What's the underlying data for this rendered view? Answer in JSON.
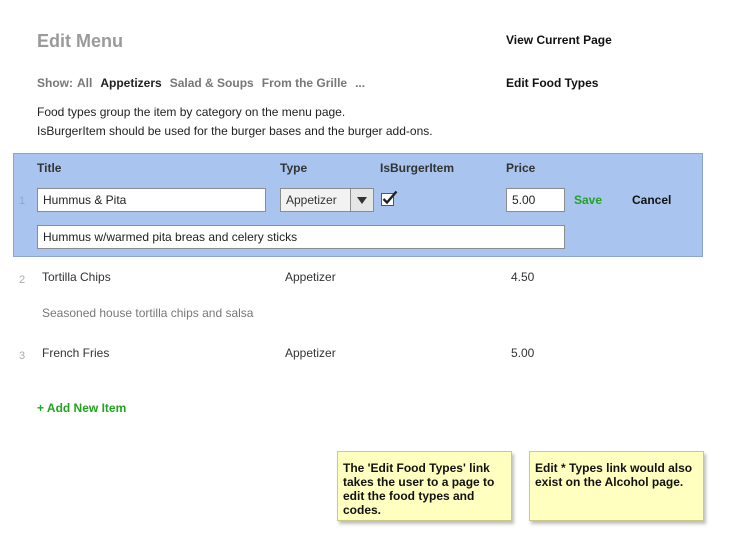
{
  "header": {
    "title": "Edit Menu",
    "view_current_page": "View Current Page",
    "edit_food_types": "Edit Food Types"
  },
  "filter": {
    "show_label": "Show:",
    "options": [
      "All",
      "Appetizers",
      "Salad & Soups",
      "From the Grille",
      "..."
    ],
    "active": "Appetizers"
  },
  "description": [
    "Food types group the item by category on the menu page.",
    "IsBurgerItem should be used for the burger bases and the burger add-ons."
  ],
  "columns": {
    "title": "Title",
    "type": "Type",
    "is_burger": "IsBurgerItem",
    "price": "Price"
  },
  "editing_row": {
    "number": "1",
    "title": "Hummus & Pita",
    "type": "Appetizer",
    "is_burger_checked": true,
    "price": "5.00",
    "description": "Hummus w/warmed pita breas and celery sticks",
    "save_label": "Save",
    "cancel_label": "Cancel"
  },
  "rows": [
    {
      "number": "2",
      "title": "Tortilla Chips",
      "type": "Appetizer",
      "price": "4.50",
      "description": "Seasoned house tortilla chips and salsa"
    },
    {
      "number": "3",
      "title": "French Fries",
      "type": "Appetizer",
      "price": "5.00"
    }
  ],
  "add_item_label": "+ Add New Item",
  "notes": [
    "The 'Edit Food Types' link takes the user to a page to edit the food types and codes.",
    "Edit * Types link would also exist on the Alcohol page."
  ],
  "colors": {
    "panel_bg": "#a8c4ef",
    "accent_green": "#22a322",
    "note_bg": "#ffffc0"
  },
  "icons": {
    "dropdown": "chevron-down-icon",
    "checkbox": "checkmark-icon"
  }
}
